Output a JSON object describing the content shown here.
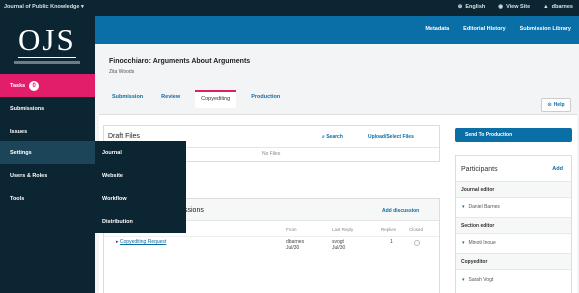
{
  "topbar": {
    "journal_name": "Journal of Public Knowledge",
    "journal_caret": "▾",
    "language": "English",
    "view_site": "View Site",
    "user": "dbarnes"
  },
  "logo": {
    "text": "OJS"
  },
  "sidebar": {
    "items": [
      {
        "label": "Tasks",
        "badge": "0"
      },
      {
        "label": "Submissions"
      },
      {
        "label": "Issues"
      },
      {
        "label": "Settings"
      },
      {
        "label": "Users & Roles"
      },
      {
        "label": "Tools"
      }
    ]
  },
  "settings_menu": {
    "items": [
      {
        "label": "Journal"
      },
      {
        "label": "Website"
      },
      {
        "label": "Workflow"
      },
      {
        "label": "Distribution"
      }
    ]
  },
  "header": {
    "links": [
      "Metadata",
      "Editorial History",
      "Submission Library"
    ]
  },
  "submission": {
    "title": "Finocchiaro: Arguments About Arguments",
    "author": "Zita Woods"
  },
  "tabs": [
    {
      "label": "Submission"
    },
    {
      "label": "Review"
    },
    {
      "label": "Copyediting",
      "active": true
    },
    {
      "label": "Production"
    }
  ],
  "help": {
    "label": "Help"
  },
  "draft_files": {
    "title": "Draft Files",
    "search": "Search",
    "upload": "Upload/Select Files",
    "empty": "No Files"
  },
  "discussions": {
    "title_suffix": "ssions",
    "add": "Add discussion",
    "columns": [
      "From",
      "Last Reply",
      "Replies",
      "Closed"
    ],
    "rows": [
      {
        "name": "Copyediting Request",
        "from_user": "dbarnes",
        "from_date": "Jul/30",
        "reply_user": "svogt",
        "reply_date": "Jul/30",
        "replies": "1"
      }
    ]
  },
  "send_button": {
    "label": "Send To Production"
  },
  "participants": {
    "title": "Participants",
    "add": "Add",
    "groups": [
      {
        "role": "Journal editor",
        "name": "Daniel Barnes"
      },
      {
        "role": "Section editor",
        "name": "Minoti Inoue"
      },
      {
        "role": "Copyeditor",
        "name": "Sarah Vogt"
      }
    ]
  },
  "colors": {
    "navy": "#0c2532",
    "blue": "#0a6ea7",
    "pink": "#e21e6b"
  }
}
